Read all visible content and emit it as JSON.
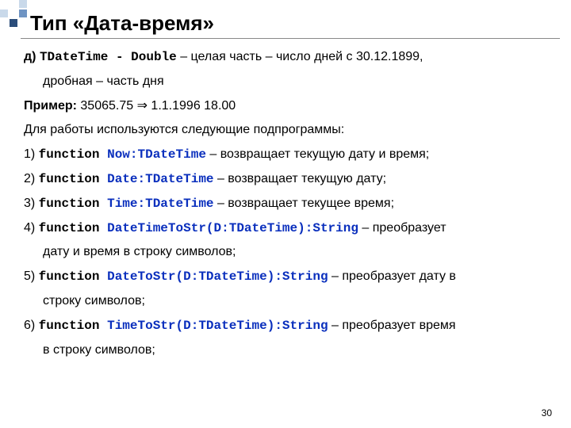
{
  "title": "Тип «Дата-время»",
  "page_number": "30",
  "intro": {
    "prefix": "д) ",
    "typedef": "TDateTime - Double",
    "rest": " – целая часть – число дней с 30.12.1899,",
    "line2": "дробная – часть дня"
  },
  "example": {
    "label": "Пример:",
    "value": "  35065.75 ⇒ 1.1.1996  18.00"
  },
  "usage_intro": "Для работы используются следующие подпрограммы:",
  "items": [
    {
      "num": "1) ",
      "kw": "function ",
      "sig": "Now:TDateTime",
      "desc": " – возвращает текущую дату и время;"
    },
    {
      "num": "2) ",
      "kw": "function ",
      "sig": "Date:TDateTime",
      "desc": " – возвращает текущую дату;"
    },
    {
      "num": "3) ",
      "kw": "function ",
      "sig": "Time:TDateTime",
      "desc": " – возвращает текущее время;"
    },
    {
      "num": "4) ",
      "kw": "function ",
      "sig": "DateTimeToStr(D:TDateTime):String",
      "desc": " – преобразует",
      "desc2": "дату и время в строку символов;"
    },
    {
      "num": "5) ",
      "kw": "function ",
      "sig": "DateToStr(D:TDateTime):String",
      "desc": " – преобразует дату в",
      "desc2": "строку символов;"
    },
    {
      "num": "6) ",
      "kw": "function ",
      "sig": "TimeToStr(D:TDateTime):String",
      "desc": " – преобразует время",
      "desc2": "в строку символов;"
    }
  ]
}
